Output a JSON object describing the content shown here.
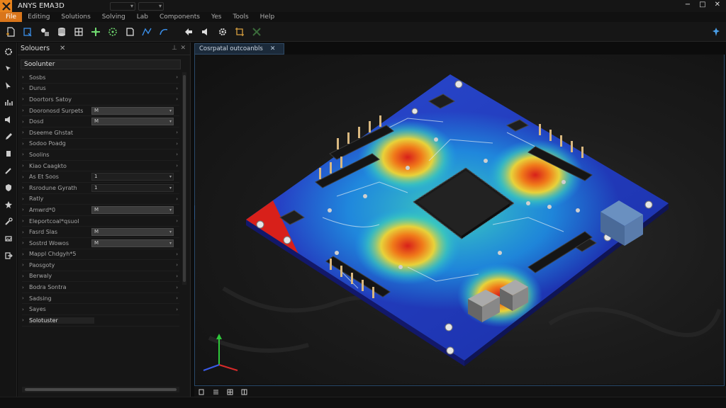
{
  "app": {
    "title": "ANYS EMA3D",
    "accent_color": "#e8831c",
    "window_controls": [
      "−",
      "□",
      "✕"
    ],
    "quick_access": [
      "▾",
      "▾"
    ]
  },
  "menu": [
    "File",
    "Editing",
    "Solutions",
    "Solving",
    "Lab",
    "Components",
    "Yes",
    "Tools",
    "Help"
  ],
  "toolbar": {
    "icons": [
      "new-document-icon",
      "sheet-icon",
      "parts-icon",
      "database-icon",
      "grid-icon",
      "mesh-icon",
      "target-icon",
      "cube-icon",
      "measure-icon",
      "curve-icon",
      "arrow-icon",
      "speaker-icon",
      "gear-icon",
      "frame-icon",
      "connector-icon"
    ]
  },
  "left_strip": {
    "icons": [
      "gear-icon",
      "cursor-icon",
      "select-icon",
      "chart-icon",
      "speaker-icon",
      "pen-icon",
      "box-icon",
      "pencil-icon",
      "shield-icon",
      "star-icon",
      "wrench-icon",
      "layer-icon",
      "export-icon"
    ]
  },
  "panel": {
    "title": "Solouers",
    "close": "✕",
    "pin": "⊥",
    "root": "Soolunter",
    "rows": [
      {
        "label": "Sosbs"
      },
      {
        "label": "Durus"
      },
      {
        "label": "Doortors Satoy"
      },
      {
        "label": "Dooronosd Surpets",
        "value": "M"
      },
      {
        "label": "Dosd",
        "value": "M"
      },
      {
        "label": "Dseeme Ghstat"
      },
      {
        "label": "Sodoo Poadg"
      },
      {
        "label": "Soolins"
      },
      {
        "label": "Kiao Caagkto"
      },
      {
        "label": "As Et Soos",
        "value": "1",
        "dark": true
      },
      {
        "label": "Rsrodune Gyrath",
        "value": "1",
        "dark": true
      },
      {
        "label": "Ratly"
      },
      {
        "label": "Amwrd*0",
        "value": "M"
      },
      {
        "label": "Eleportcoal*qsuol"
      },
      {
        "label": "Fasrd Slas",
        "value": "M"
      },
      {
        "label": "Sostrd Wowos",
        "value": "M"
      },
      {
        "label": "Mappl Chdgyh*5"
      },
      {
        "label": "Paosgoty"
      },
      {
        "label": "Berwaly"
      },
      {
        "label": "Bodra Sontra"
      },
      {
        "label": "Sadsing"
      },
      {
        "label": "Sayes"
      },
      {
        "label": "Solotuster",
        "selected": true
      }
    ]
  },
  "viewport": {
    "tab": "Cosrpatal outcoanbls",
    "tab_close": "✕",
    "bottom_icons": [
      "copy-icon",
      "layers-icon",
      "table-icon",
      "split-icon"
    ]
  },
  "heatmap_colors": [
    "#1f3fc8",
    "#1ea6e8",
    "#3fd0b8",
    "#e8d23a",
    "#f07a1a",
    "#d8201a"
  ]
}
